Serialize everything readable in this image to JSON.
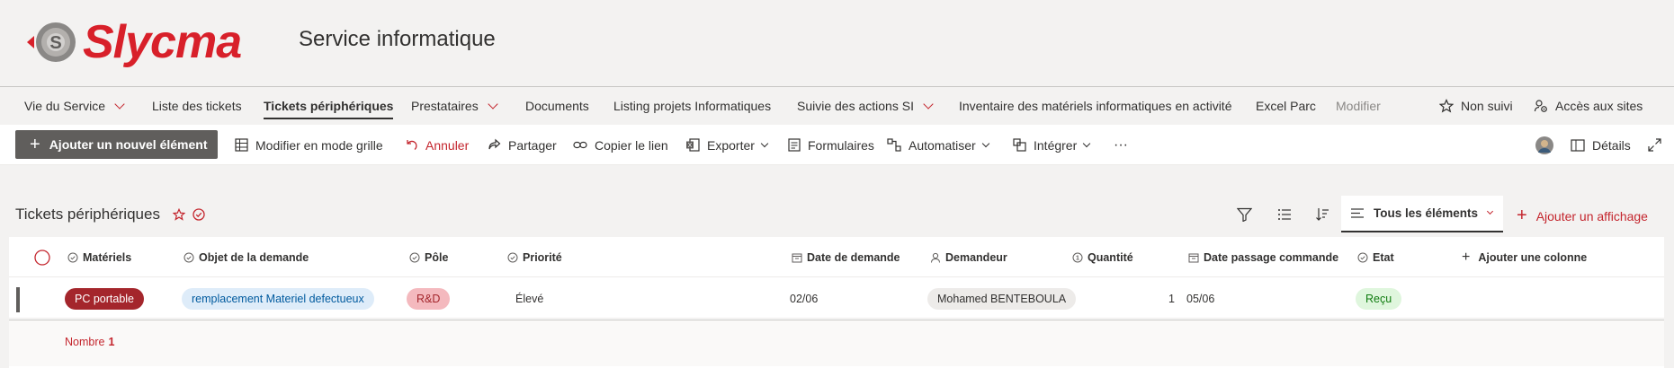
{
  "header": {
    "logo_text": "Slycma",
    "site_title": "Service informatique"
  },
  "nav": {
    "items": [
      {
        "label": "Vie du Service"
      },
      {
        "label": "Liste des tickets"
      },
      {
        "label": "Tickets périphériques"
      },
      {
        "label": "Prestataires"
      },
      {
        "label": "Documents"
      },
      {
        "label": "Listing projets Informatiques"
      },
      {
        "label": "Suivie des actions SI"
      },
      {
        "label": "Inventaire des matériels informatiques en activité"
      },
      {
        "label": "Excel Parc"
      },
      {
        "label": "Modifier"
      }
    ],
    "follow_label": "Non suivi",
    "access_label": "Accès aux sites"
  },
  "commands": {
    "new_item": "Ajouter un nouvel élément",
    "grid_edit": "Modifier en mode grille",
    "undo": "Annuler",
    "share": "Partager",
    "copy_link": "Copier le lien",
    "export": "Exporter",
    "forms": "Formulaires",
    "automate": "Automatiser",
    "integrate": "Intégrer",
    "more": "···",
    "details": "Détails"
  },
  "list": {
    "title": "Tickets périphériques",
    "view_name": "Tous les éléments",
    "add_view": "Ajouter un affichage",
    "columns": {
      "materiels": "Matériels",
      "objet": "Objet de la demande",
      "pole": "Pôle",
      "priorite": "Priorité",
      "date_demande": "Date de demande",
      "demandeur": "Demandeur",
      "quantite": "Quantité",
      "date_commande": "Date passage commande",
      "etat": "Etat",
      "add_column": "Ajouter une colonne"
    },
    "rows": [
      {
        "materiels": "PC portable",
        "objet": "remplacement Materiel defectueux",
        "pole": "R&D",
        "priorite": "Élevé",
        "date_demande": "02/06",
        "demandeur": "Mohamed BENTEBOULA",
        "quantite": "1",
        "date_commande": "05/06",
        "etat": "Reçu"
      }
    ],
    "count_label": "Nombre",
    "count_value": "1"
  },
  "colors": {
    "accent": "#c4262e",
    "logo_red": "#d8202a",
    "pill_materiels_bg": "#a4262c",
    "pill_objet_bg": "#deecf9",
    "pill_pole_bg": "#f4b9be",
    "pill_demandeur_bg": "#edebe9",
    "pill_etat_bg": "#dff6dd"
  }
}
